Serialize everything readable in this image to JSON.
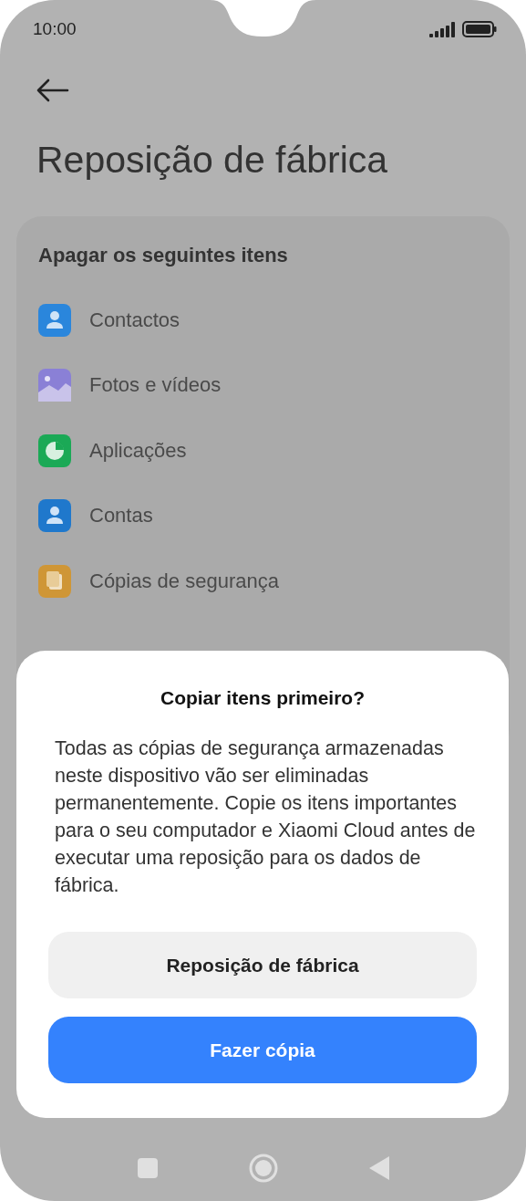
{
  "status_bar": {
    "time": "10:00"
  },
  "title": "Reposição de fábrica",
  "card": {
    "heading": "Apagar os seguintes itens",
    "items": [
      {
        "label": "Contactos",
        "kind": "person"
      },
      {
        "label": "Fotos e vídeos",
        "kind": "photo"
      },
      {
        "label": "Aplicações",
        "kind": "apps"
      },
      {
        "label": "Contas",
        "kind": "account"
      },
      {
        "label": "Cópias de segurança",
        "kind": "backup"
      }
    ]
  },
  "dialog": {
    "title": "Copiar itens primeiro?",
    "message": "Todas as cópias de segurança armazenadas neste dispositivo vão ser eliminadas permanentemente. Copie os itens importantes para o seu computador e Xiaomi Cloud antes de executar uma reposição para os dados de fábrica.",
    "buttons": [
      {
        "label": "Reposição de fábrica",
        "kind": "secondary"
      },
      {
        "label": "Fazer cópia",
        "kind": "primary"
      }
    ]
  }
}
